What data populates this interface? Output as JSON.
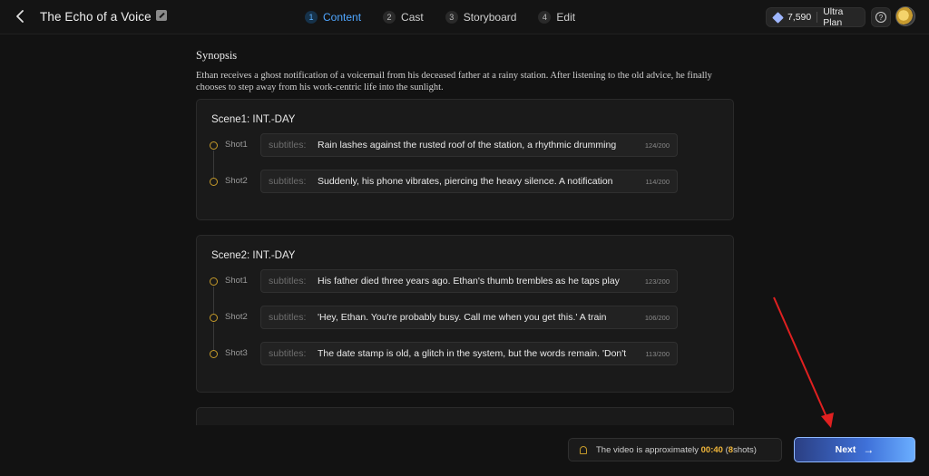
{
  "header": {
    "title": "The Echo of a Voice",
    "steps": [
      {
        "num": "1",
        "label": "Content",
        "active": true
      },
      {
        "num": "2",
        "label": "Cast",
        "active": false
      },
      {
        "num": "3",
        "label": "Storyboard",
        "active": false
      },
      {
        "num": "4",
        "label": "Edit",
        "active": false
      }
    ],
    "credits": "7,590",
    "plan": "Ultra Plan",
    "help_glyph": "?"
  },
  "synopsis": {
    "title": "Synopsis",
    "text": "Ethan receives a ghost notification of a voicemail from his deceased father at a rainy station. After listening to the old advice, he finally chooses to step away from his work-centric life into the sunlight."
  },
  "scenes": [
    {
      "title": "Scene1: INT.-DAY",
      "shots": [
        {
          "label": "Shot1",
          "placeholder": "subtitles:",
          "text": "Rain lashes against the rusted roof of the station, a rhythmic drumming",
          "count": "124/200"
        },
        {
          "label": "Shot2",
          "placeholder": "subtitles:",
          "text": "Suddenly, his phone vibrates, piercing the heavy silence. A notification",
          "count": "114/200"
        }
      ]
    },
    {
      "title": "Scene2: INT.-DAY",
      "shots": [
        {
          "label": "Shot1",
          "placeholder": "subtitles:",
          "text": "His father died three years ago. Ethan's thumb trembles as he taps play",
          "count": "123/200"
        },
        {
          "label": "Shot2",
          "placeholder": "subtitles:",
          "text": "'Hey, Ethan. You're probably busy. Call me when you get this.' A train",
          "count": "106/200"
        },
        {
          "label": "Shot3",
          "placeholder": "subtitles:",
          "text": "The date stamp is old, a glitch in the system, but the words remain. 'Don't",
          "count": "113/200"
        }
      ]
    }
  ],
  "footer": {
    "notice_prefix": "The video is approximately",
    "duration": "00:40",
    "shots_open": "(",
    "shot_count": "8",
    "shots_close": " shots)",
    "next_label": "Next",
    "next_arrow": "→"
  },
  "colors": {
    "accent_blue": "#4fa6ff",
    "gold": "#f0b63a",
    "annotation_red": "#e02020"
  }
}
